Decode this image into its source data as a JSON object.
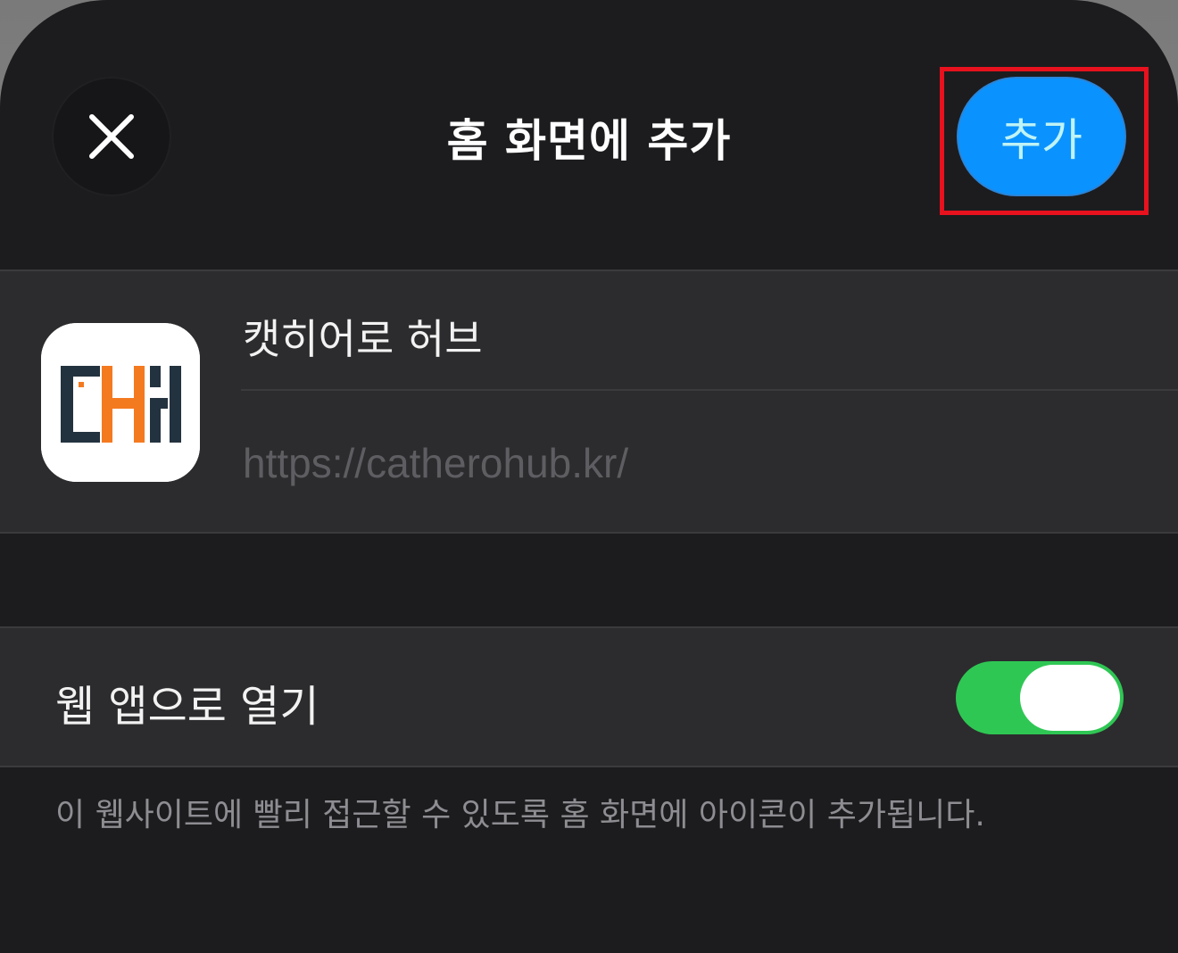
{
  "header": {
    "title": "홈 화면에 추가",
    "close_icon": "close-icon",
    "add_label": "추가",
    "add_color": "#0a93ff",
    "highlight_color": "#e8111e"
  },
  "app": {
    "icon": "catherohub-logo",
    "name": "캣히어로 허브",
    "url": "https://catherohub.kr/"
  },
  "webapp": {
    "label": "웹 앱으로 열기",
    "toggle_on": true,
    "toggle_color": "#2fc754"
  },
  "footnote": "이 웹사이트에 빨리 접근할 수 있도록 홈 화면에 아이콘이 추가됩니다."
}
